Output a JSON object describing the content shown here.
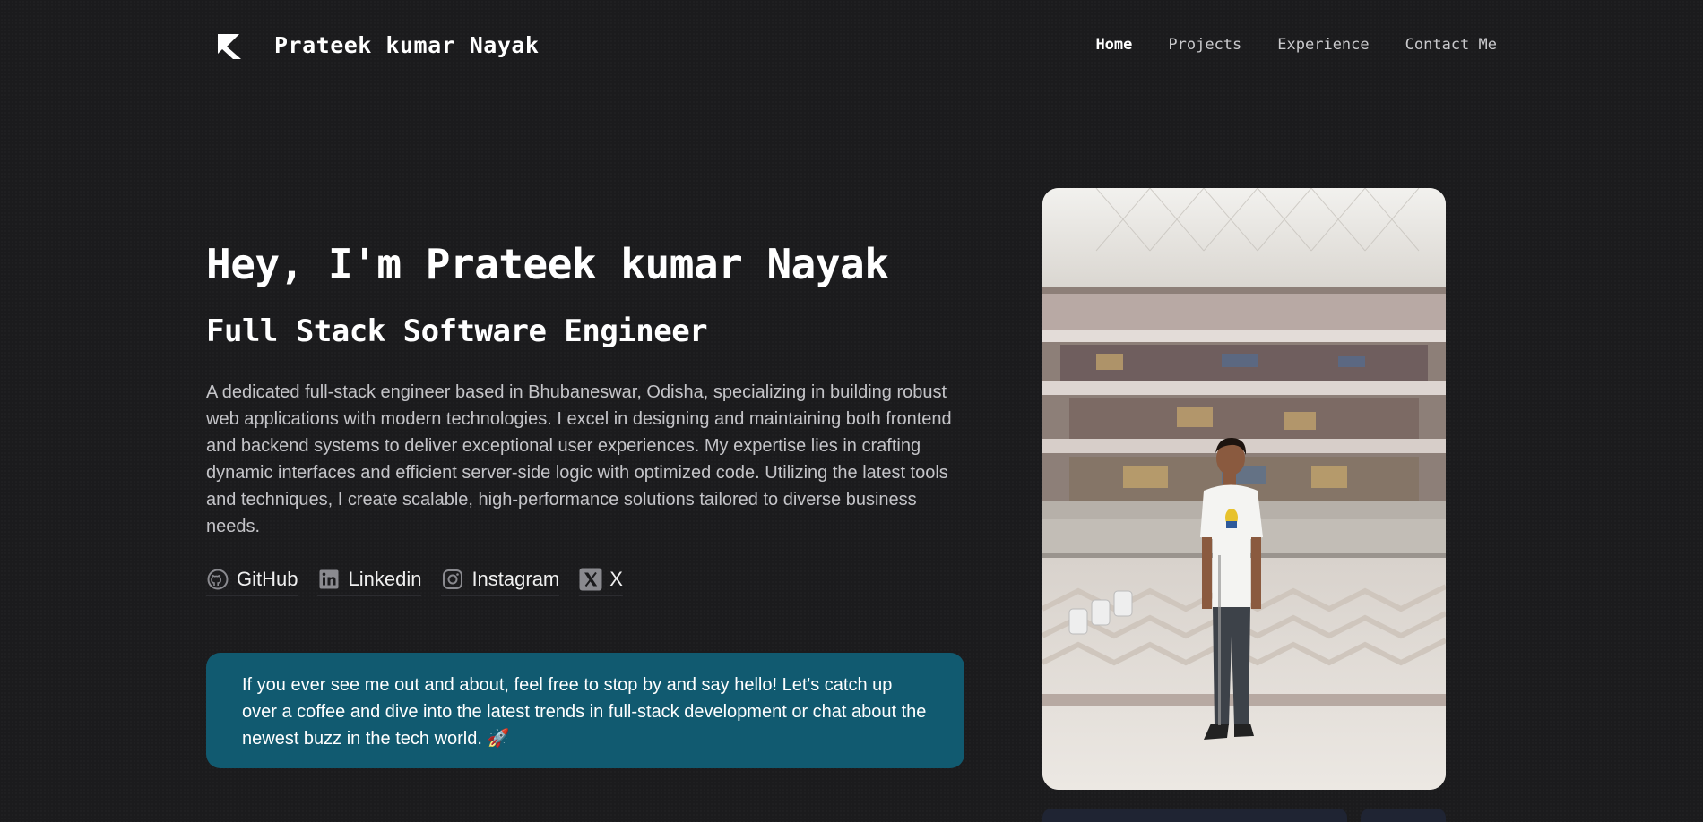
{
  "header": {
    "site_title": "Prateek kumar Nayak",
    "nav": [
      {
        "label": "Home",
        "active": true
      },
      {
        "label": "Projects",
        "active": false
      },
      {
        "label": "Experience",
        "active": false
      },
      {
        "label": "Contact Me",
        "active": false
      }
    ]
  },
  "hero": {
    "title": "Hey, I'm Prateek kumar Nayak",
    "subtitle": "Full Stack Software Engineer",
    "bio": "A dedicated full-stack engineer based in Bhubaneswar, Odisha, specializing in building robust web applications with modern technologies. I excel in designing and maintaining both frontend and backend systems to deliver exceptional user experiences. My expertise lies in crafting dynamic interfaces and efficient server-side logic with optimized code. Utilizing the latest tools and techniques, I create scalable, high-performance solutions tailored to diverse business needs."
  },
  "socials": [
    {
      "label": "GitHub",
      "icon": "github-icon"
    },
    {
      "label": "Linkedin",
      "icon": "linkedin-icon"
    },
    {
      "label": "Instagram",
      "icon": "instagram-icon"
    },
    {
      "label": "X",
      "icon": "x-icon"
    }
  ],
  "callout": {
    "text": "If you ever see me out and about, feel free to stop by and say hello! Let's catch up over a coffee and dive into the latest trends in full-stack development or chat about the newest buzz in the tech world. 🚀",
    "background": "#115a70"
  },
  "colors": {
    "page_background": "#1b1b1d",
    "accent": "#115a70"
  }
}
